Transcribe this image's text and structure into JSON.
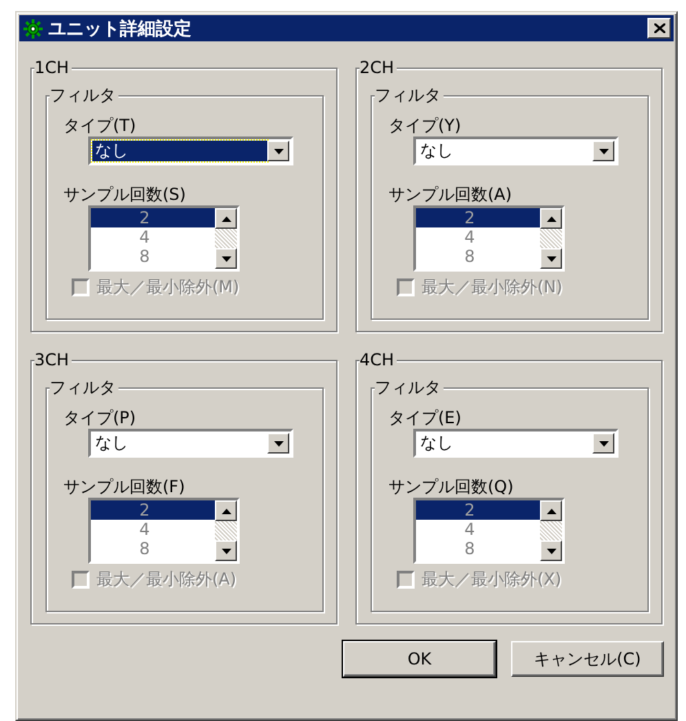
{
  "window": {
    "title": "ユニット詳細設定"
  },
  "channels": [
    {
      "title": "1CH",
      "filter_title": "フィルタ",
      "type_label": "タイプ(T)",
      "type_value": "なし",
      "type_focused": true,
      "sample_label": "サンプル回数(S)",
      "samples_disabled": true,
      "samples": [
        {
          "label": "2",
          "selected": true
        },
        {
          "label": "4",
          "selected": false
        },
        {
          "label": "8",
          "selected": false
        }
      ],
      "checkbox": {
        "label": "最大／最小除外(M)",
        "checked": false,
        "disabled": true
      }
    },
    {
      "title": "2CH",
      "filter_title": "フィルタ",
      "type_label": "タイプ(Y)",
      "type_value": "なし",
      "type_focused": false,
      "sample_label": "サンプル回数(A)",
      "samples_disabled": true,
      "samples": [
        {
          "label": "2",
          "selected": true
        },
        {
          "label": "4",
          "selected": false
        },
        {
          "label": "8",
          "selected": false
        }
      ],
      "checkbox": {
        "label": "最大／最小除外(N)",
        "checked": false,
        "disabled": true
      }
    },
    {
      "title": "3CH",
      "filter_title": "フィルタ",
      "type_label": "タイプ(P)",
      "type_value": "なし",
      "type_focused": false,
      "sample_label": "サンプル回数(F)",
      "samples_disabled": true,
      "samples": [
        {
          "label": "2",
          "selected": true
        },
        {
          "label": "4",
          "selected": false
        },
        {
          "label": "8",
          "selected": false
        }
      ],
      "checkbox": {
        "label": "最大／最小除外(A)",
        "checked": false,
        "disabled": true
      }
    },
    {
      "title": "4CH",
      "filter_title": "フィルタ",
      "type_label": "タイプ(E)",
      "type_value": "なし",
      "type_focused": false,
      "sample_label": "サンプル回数(Q)",
      "samples_disabled": true,
      "samples": [
        {
          "label": "2",
          "selected": true
        },
        {
          "label": "4",
          "selected": false
        },
        {
          "label": "8",
          "selected": false
        }
      ],
      "checkbox": {
        "label": "最大／最小除外(X)",
        "checked": false,
        "disabled": true
      }
    }
  ],
  "buttons": [
    {
      "label": "OK",
      "default": true
    },
    {
      "label": "キャンセル(C)",
      "default": false
    }
  ]
}
